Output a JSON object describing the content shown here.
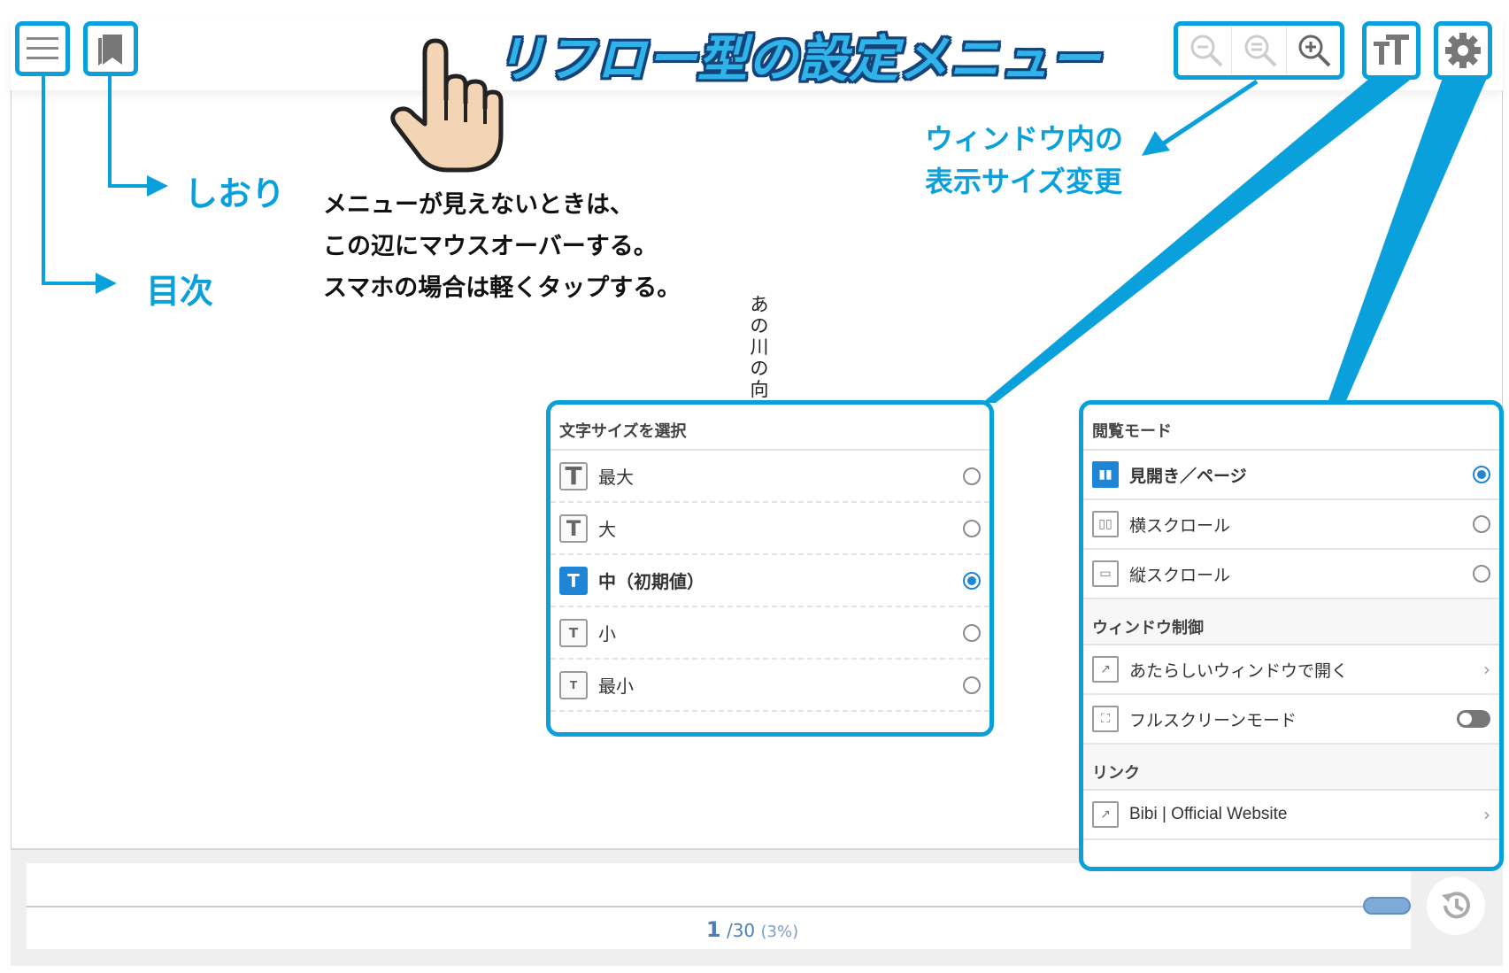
{
  "title_banner": "リフロー型の設定メニュー",
  "callouts": {
    "bookmark": "しおり",
    "toc": "目次",
    "window_zoom_line1": "ウィンドウ内の",
    "window_zoom_line2": "表示サイズ変更"
  },
  "hint": {
    "line1": "メニューが見えないときは、",
    "line2": "この辺にマウスオーバーする。",
    "line3": "スマホの場合は軽くタップする。"
  },
  "book_text": [
    "あ",
    "の",
    "川",
    "の",
    "向"
  ],
  "font_panel": {
    "title": "文字サイズを選択",
    "options": [
      {
        "label": "最大",
        "glyph": "T",
        "selected": false
      },
      {
        "label": "大",
        "glyph": "T",
        "selected": false
      },
      {
        "label": "中（初期値）",
        "glyph": "T",
        "selected": true
      },
      {
        "label": "小",
        "glyph": "T",
        "selected": false
      },
      {
        "label": "最小",
        "glyph": "T",
        "selected": false
      }
    ]
  },
  "settings_panel": {
    "view_mode_title": "閲覧モード",
    "view_modes": [
      {
        "label": "見開き／ページ",
        "selected": true
      },
      {
        "label": "横スクロール",
        "selected": false
      },
      {
        "label": "縦スクロール",
        "selected": false
      }
    ],
    "window_title": "ウィンドウ制御",
    "window_items": [
      {
        "label": "あたらしいウィンドウで開く"
      },
      {
        "label": "フルスクリーンモード"
      }
    ],
    "link_title": "リンク",
    "link_items": [
      {
        "label": "Bibi | Official Website"
      }
    ]
  },
  "pagination": {
    "current": "1",
    "total": "/30",
    "percent": "(3%)",
    "progress_fraction": 0.03
  },
  "colors": {
    "accent": "#0aa0dc",
    "selected": "#1f86d6",
    "banner_outline": "#14437a"
  }
}
